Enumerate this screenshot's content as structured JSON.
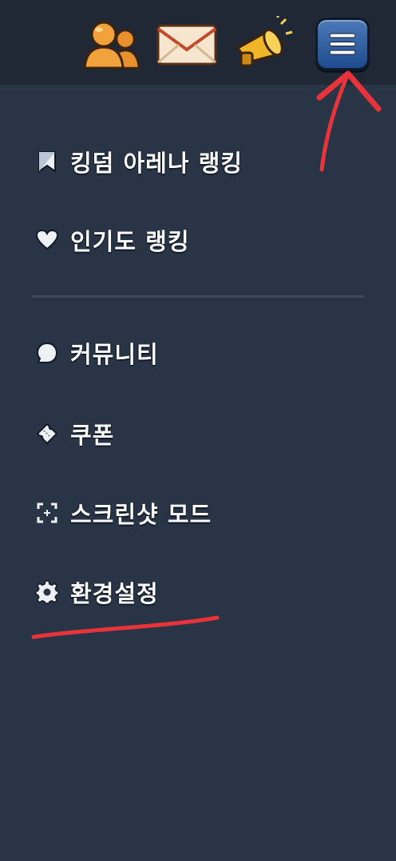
{
  "topbar": {
    "icons": [
      "friends-icon",
      "mail-icon",
      "megaphone-icon",
      "hamburger-menu-icon"
    ]
  },
  "menu": {
    "items": [
      {
        "label": "킹덤 아레나 랭킹",
        "icon": "flag-icon"
      },
      {
        "label": "인기도 랭킹",
        "icon": "heart-icon"
      },
      {
        "label": "커뮤니티",
        "icon": "chat-bubble-icon"
      },
      {
        "label": "쿠폰",
        "icon": "ticket-icon"
      },
      {
        "label": "스크린샷 모드",
        "icon": "screenshot-icon"
      },
      {
        "label": "환경설정",
        "icon": "gear-icon"
      }
    ]
  },
  "colors": {
    "background": "#293546",
    "topbar": "#1f2834",
    "annotation": "#e8333a",
    "menu_button": "#2f5fa3"
  }
}
